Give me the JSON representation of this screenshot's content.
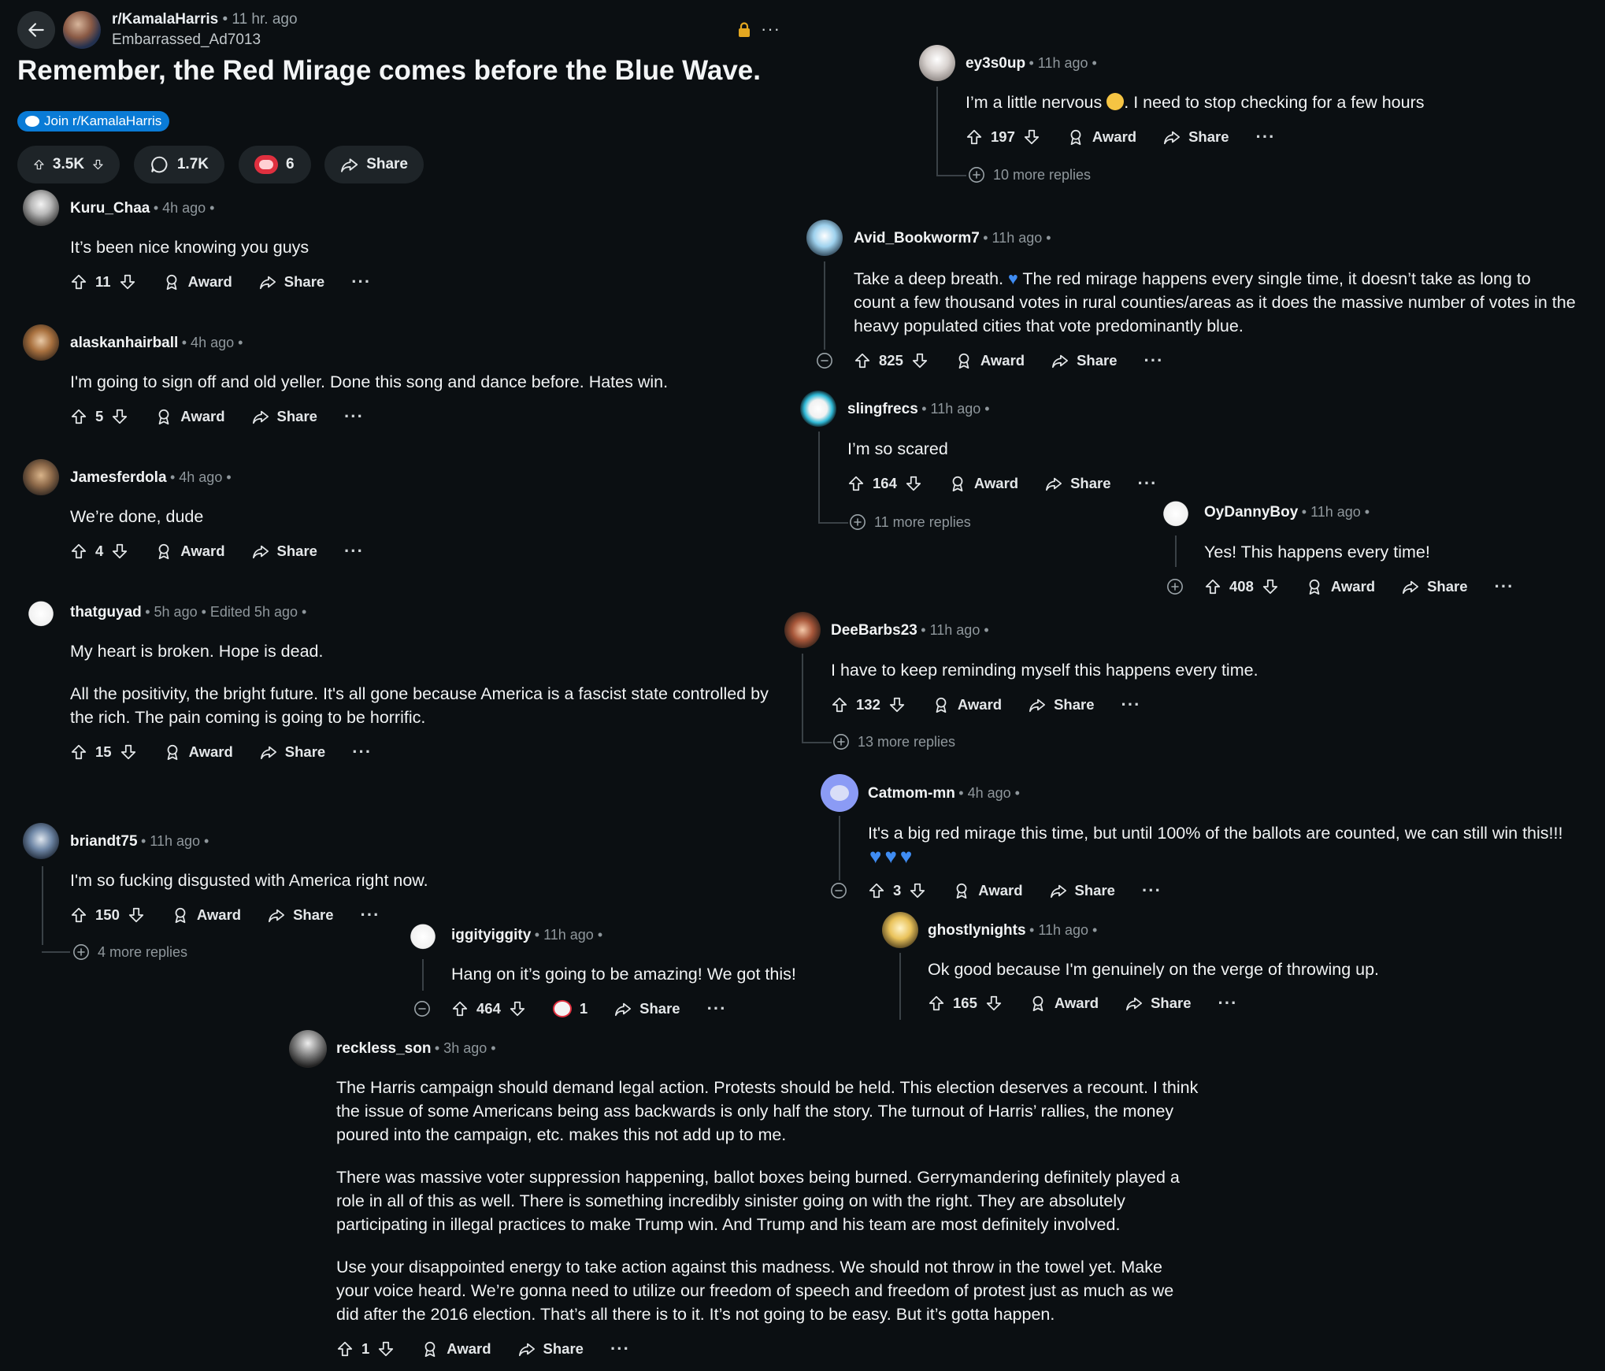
{
  "post": {
    "subreddit": "r/KamalaHarris",
    "time": "11 hr. ago",
    "author": "Embarrassed_Ad7013",
    "title": "Remember, the Red Mirage comes before the Blue Wave.",
    "join_label": "Join r/KamalaHarris",
    "upvotes": "3.5K",
    "comments": "1.7K",
    "awards": "6",
    "share": "Share"
  },
  "labels": {
    "award": "Award",
    "share": "Share",
    "dots": "···"
  },
  "comments": {
    "kuru": {
      "user": "Kuru_Chaa",
      "meta": "• 4h ago •",
      "text": "It’s been nice knowing you guys",
      "votes": "11"
    },
    "alaskan": {
      "user": "alaskanhairball",
      "meta": "• 4h ago •",
      "text": "I'm going to sign off and old yeller. Done this song and dance before. Hates win.",
      "votes": "5"
    },
    "james": {
      "user": "Jamesferdola",
      "meta": "• 4h ago •",
      "text": "We’re done, dude",
      "votes": "4"
    },
    "thatguyad": {
      "user": "thatguyad",
      "meta": "• 5h ago • Edited 5h ago •",
      "text1": "My heart is broken. Hope is dead.",
      "text2a": "All the positivity, the bright future. It's all gone because America is a fascist state controlled by",
      "text2b": "the rich. The pain coming is going to be horrific.",
      "votes": "15"
    },
    "briandt": {
      "user": "briandt75",
      "meta": "• 11h ago •",
      "text": "I'm so fucking disgusted with America right now.",
      "votes": "150",
      "more": "4 more replies"
    },
    "iggity": {
      "user": "iggityiggity",
      "meta": "• 11h ago •",
      "text": "Hang on it’s going to be amazing! We got this!",
      "votes": "464",
      "awards": "1"
    },
    "reckless": {
      "user": "reckless_son",
      "meta": "• 3h ago •",
      "p1a": "The Harris campaign should demand legal action. Protests should be held. This election deserves a recount. I think",
      "p1b": "the issue of some Americans being ass backwards is only half the story. The turnout of Harris’ rallies, the money",
      "p1c": "poured into the campaign, etc. makes this not add up to me.",
      "p2a": "There was massive voter suppression happening, ballot boxes being burned. Gerrymandering definitely played a",
      "p2b": "role in all of this as well. There is something incredibly sinister going on with the right. They are absolutely",
      "p2c": "participating in illegal practices to make Trump win. And Trump and his team are most definitely involved.",
      "p3a": "Use your disappointed energy to take action against this madness. We should not throw in the towel yet. Make",
      "p3b": "your voice heard. We’re gonna need to utilize our freedom of speech and freedom of protest just as much as we",
      "p3c": "did after the 2016 election. That’s all there is to it. It’s not going to be easy. But it’s gotta happen.",
      "votes": "1"
    },
    "ey3s": {
      "user": "ey3s0up",
      "meta": "• 11h ago •",
      "text_a": "I’m a little nervous",
      "text_b": ". I need to stop checking for a few hours",
      "votes": "197",
      "more": "10 more replies"
    },
    "avid": {
      "user": "Avid_Bookworm7",
      "meta": "• 11h ago •",
      "l1a": "Take a deep breath.",
      "l1b": "The red mirage happens every single time, it doesn’t take as long to",
      "l2": "count a few thousand votes in rural counties/areas as it does the massive number of votes in the",
      "l3": "heavy populated cities that vote predominantly blue.",
      "votes": "825"
    },
    "sling": {
      "user": "slingfrecs",
      "meta": "• 11h ago •",
      "text": "I’m so scared",
      "votes": "164",
      "more": "11 more replies"
    },
    "oydanny": {
      "user": "OyDannyBoy",
      "meta": "• 11h ago •",
      "text": "Yes! This happens every time!",
      "votes": "408"
    },
    "dee": {
      "user": "DeeBarbs23",
      "meta": "• 11h ago •",
      "text": "I have to keep reminding myself this happens every time.",
      "votes": "132",
      "more": "13 more replies"
    },
    "catmom": {
      "user": "Catmom-mn",
      "meta": "• 4h ago •",
      "text": "It's a big red mirage this time, but until 100% of the ballots are counted, we can still win this!!!",
      "votes": "3"
    },
    "ghostly": {
      "user": "ghostlynights",
      "meta": "• 11h ago •",
      "text": "Ok good because I'm genuinely on the verge of throwing up.",
      "votes": "165"
    }
  },
  "colors": {
    "background": "#0b0f12",
    "join_blue": "#0a7bd6",
    "heart_blue": "#3f8cf2",
    "pill": "#1e2428"
  }
}
